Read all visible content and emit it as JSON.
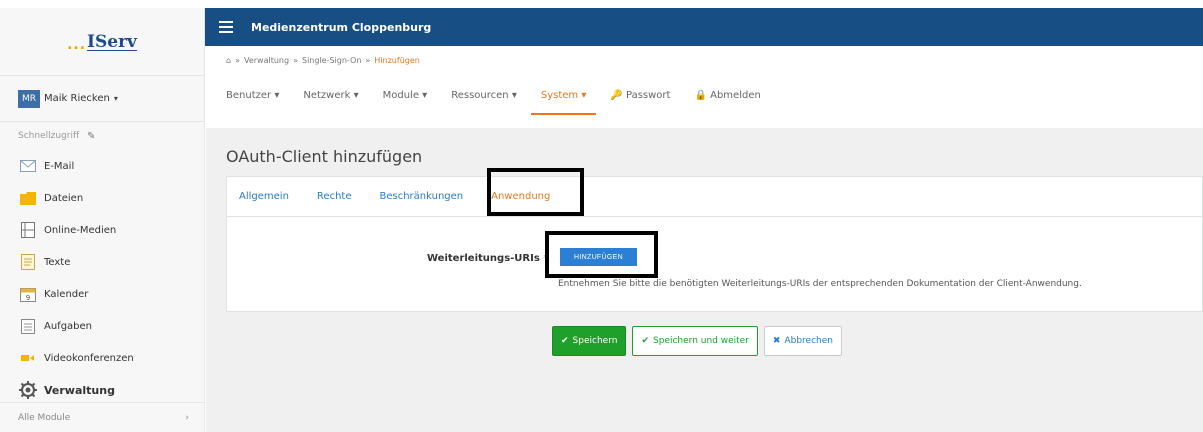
{
  "sidebar": {
    "logo_dots": "...",
    "logo_name": "IServ",
    "user_initials": "MR",
    "user_name": "Maik Riecken",
    "quickaccess_label": "Schnellzugriff",
    "items": [
      {
        "label": "E-Mail",
        "icon": "envelope-icon"
      },
      {
        "label": "Dateien",
        "icon": "folder-icon"
      },
      {
        "label": "Online-Medien",
        "icon": "media-icon"
      },
      {
        "label": "Texte",
        "icon": "text-document-icon"
      },
      {
        "label": "Kalender",
        "icon": "calendar-icon"
      },
      {
        "label": "Aufgaben",
        "icon": "clipboard-icon"
      },
      {
        "label": "Videokonferenzen",
        "icon": "video-icon"
      },
      {
        "label": "Verwaltung",
        "icon": "gear-icon"
      }
    ],
    "all_modules": "Alle Module"
  },
  "header": {
    "title": "Medienzentrum Cloppenburg"
  },
  "breadcrumb": {
    "items": [
      "Verwaltung",
      "Single-Sign-On",
      "Hinzufügen"
    ]
  },
  "mainnav": {
    "items": [
      "Benutzer",
      "Netzwerk",
      "Module",
      "Ressourcen",
      "System",
      "Passwort",
      "Abmelden"
    ]
  },
  "page": {
    "title": "OAuth-Client hinzufügen",
    "tabs": [
      "Allgemein",
      "Rechte",
      "Beschränkungen",
      "Anwendung"
    ],
    "field_label": "Weiterleitungs-URIs",
    "required_mark": "*",
    "add_button": "HINZUFÜGEN",
    "help_text": "Entnehmen Sie bitte die benötigten Weiterleitungs-URIs der entsprechenden Dokumentation der Client-Anwendung."
  },
  "actions": {
    "save": "Speichern",
    "save_next": "Speichern und weiter",
    "cancel": "Abbrechen"
  },
  "colors": {
    "topbar": "#174f84",
    "accent": "#e87722",
    "link": "#2a7ac7",
    "save": "#1fa02a",
    "primary_button": "#2b7fd4"
  }
}
